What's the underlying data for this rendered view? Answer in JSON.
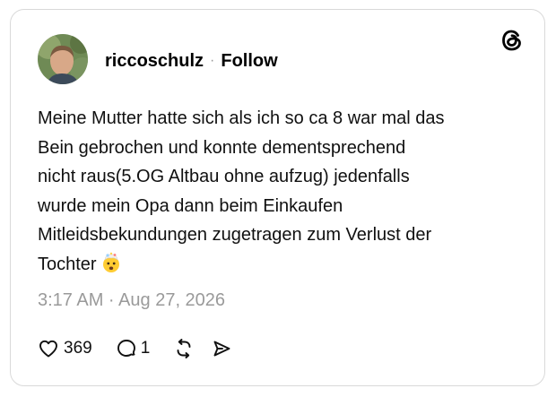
{
  "post": {
    "username": "riccoschulz",
    "separator": "·",
    "follow_label": "Follow",
    "text_lines": [
      "Meine Mutter hatte sich als ich so ca 8 war mal das",
      "Bein gebrochen und konnte dementsprechend",
      "nicht raus(5.OG Altbau ohne aufzug) jedenfalls",
      "wurde mein Opa dann beim Einkaufen",
      "Mitleidsbekundungen zugetragen zum Verlust der",
      "Tochter"
    ],
    "emoji": "exploding-head",
    "timestamp": "3:17 AM · Aug 27, 2026",
    "like_count": "369",
    "reply_count": "1"
  },
  "icons": {
    "brand": "threads-logo-icon",
    "like": "heart-icon",
    "reply": "comment-icon",
    "repost": "repost-icon",
    "share": "share-icon"
  },
  "colors": {
    "text": "#101010",
    "muted": "#9a9a9a",
    "border": "#d9d9d9"
  }
}
